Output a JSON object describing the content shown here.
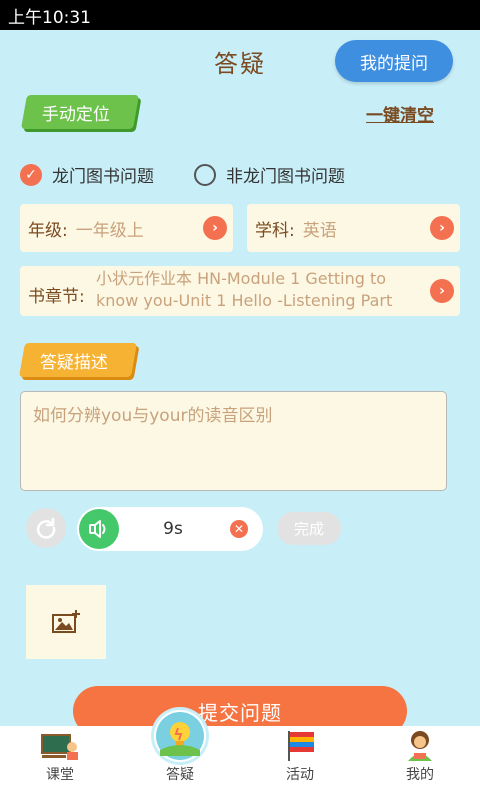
{
  "status_bar": {
    "time": "上午10:31"
  },
  "header": {
    "title": "答疑",
    "my_questions_button": "我的提问"
  },
  "locate_tag": "手动定位",
  "clear_link": "一键清空",
  "radios": [
    {
      "label": "龙门图书问题",
      "checked": true
    },
    {
      "label": "非龙门图书问题",
      "checked": false
    }
  ],
  "grade": {
    "label": "年级:",
    "value": "一年级上"
  },
  "subject": {
    "label": "学科:",
    "value": "英语"
  },
  "chapter": {
    "label": "书章节:",
    "value": "小状元作业本 HN-Module 1 Getting to know you-Unit 1 Hello  -Listening Part"
  },
  "description_tag": "答疑描述",
  "description": {
    "text": "如何分辨you与your的读音区别"
  },
  "audio": {
    "duration": "9s",
    "done_label": "完成"
  },
  "submit_label": "提交问题",
  "bottom_nav": [
    {
      "label": "课堂",
      "icon": "classroom-icon"
    },
    {
      "label": "答疑",
      "icon": "qa-bulb-icon",
      "active": true
    },
    {
      "label": "活动",
      "icon": "flag-icon"
    },
    {
      "label": "我的",
      "icon": "profile-icon"
    }
  ],
  "colors": {
    "background": "#c8eef8",
    "accent_orange": "#f37050",
    "primary_blue": "#3f8fe0",
    "submit_orange": "#f57442",
    "green_tag": "#6cc24a",
    "yellow_tag": "#f6b233",
    "field_bg": "#fdf8e4"
  }
}
